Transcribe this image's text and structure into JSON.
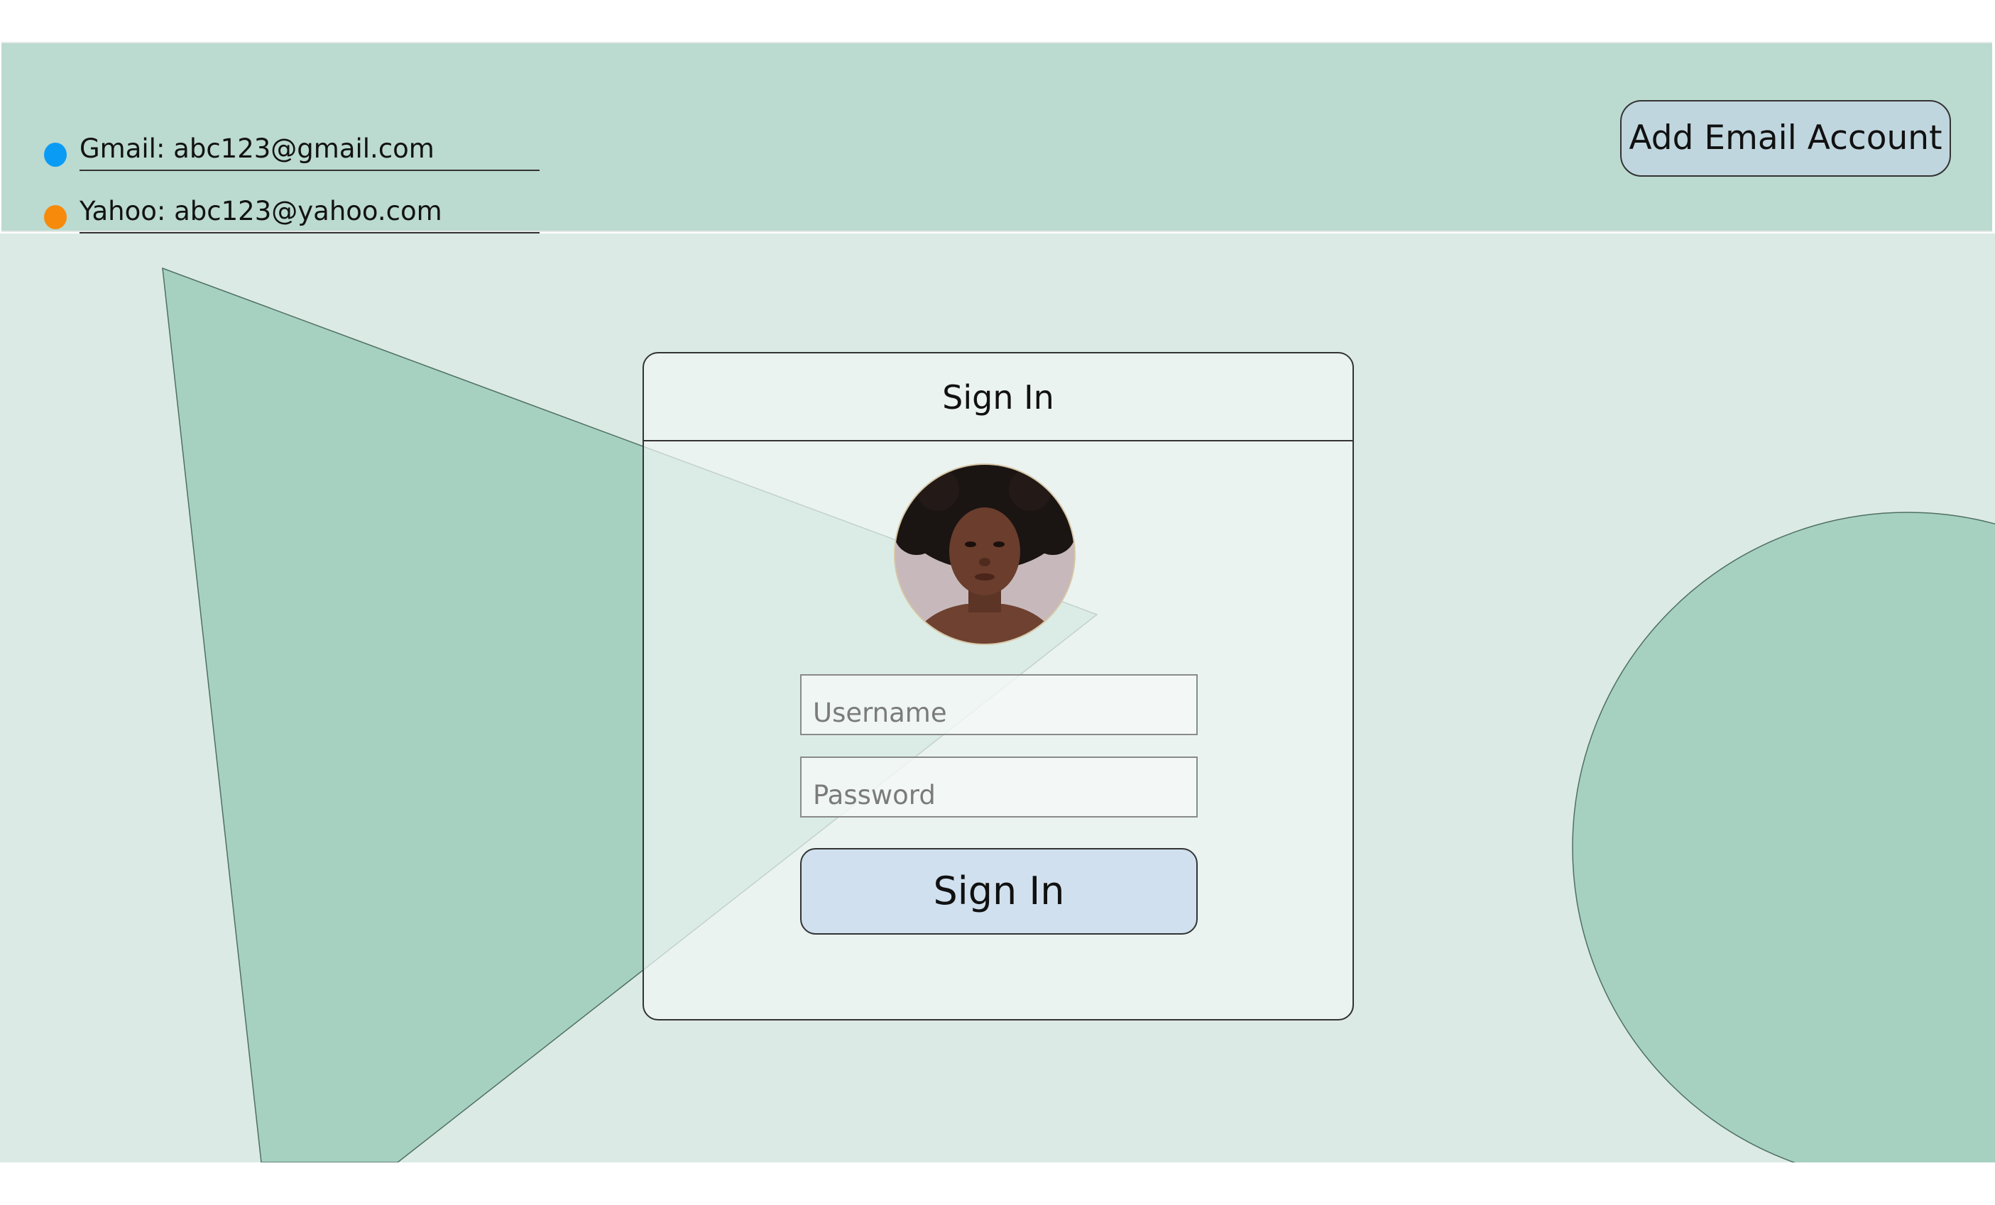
{
  "accounts": [
    {
      "label": "Gmail: abc123@gmail.com",
      "dot_color": "#0a9bf5"
    },
    {
      "label": "Yahoo: abc123@yahoo.com",
      "dot_color": "#f78a0b"
    }
  ],
  "header": {
    "add_account_label": "Add Email Account"
  },
  "signin": {
    "title": "Sign In",
    "username_placeholder": "Username",
    "password_placeholder": "Password",
    "button_label": "Sign In"
  },
  "colors": {
    "account_bar_bg": "#bbdad0",
    "main_bg": "#dbeae4",
    "shape_fill": "#a6d1c1",
    "add_button_bg": "#c0d6de",
    "signin_button_bg": "#d0e0ee"
  },
  "icons": {
    "avatar": "user-avatar-photo"
  }
}
